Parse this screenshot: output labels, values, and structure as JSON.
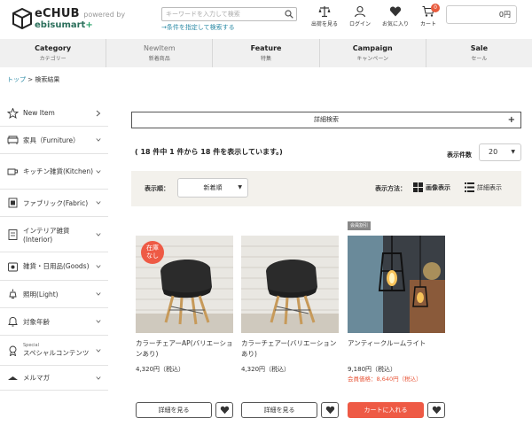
{
  "logo": {
    "name": "eCHUB",
    "powered": "powered by",
    "sub_main": "ebisumart",
    "sub_plus": "+"
  },
  "search": {
    "placeholder": "キーワードを入力して検索",
    "link": "→条件を指定して検索する"
  },
  "header_icons": [
    {
      "label": "出荷を見る",
      "icon": "scale-icon"
    },
    {
      "label": "ログイン",
      "icon": "user-icon"
    },
    {
      "label": "お気に入り",
      "icon": "heart-icon"
    },
    {
      "label": "カート",
      "icon": "cart-icon",
      "badge": "0"
    }
  ],
  "cart_total": "0円",
  "nav": [
    {
      "en": "Category",
      "jp": "カテゴリー"
    },
    {
      "en": "NewItem",
      "jp": "新着商品"
    },
    {
      "en": "Feature",
      "jp": "特集"
    },
    {
      "en": "Campaign",
      "jp": "キャンペーン"
    },
    {
      "en": "Sale",
      "jp": "セール"
    }
  ],
  "breadcrumb": {
    "home": "トップ",
    "sep": " > ",
    "current": "検索結果"
  },
  "sidebar": [
    {
      "label": "New Item",
      "icon": "star-icon"
    },
    {
      "label": "家具（Furniture）",
      "icon": "sofa-icon"
    },
    {
      "label": "キッチン雑貨(Kitchen)",
      "icon": "cup-icon"
    },
    {
      "label": "ファブリック(Fabric)",
      "icon": "fabric-icon"
    },
    {
      "label": "インテリア雑貨(Interior)",
      "icon": "frame-icon"
    },
    {
      "label": "雑貨・日用品(Goods)",
      "icon": "goods-icon"
    },
    {
      "label": "照明(Light)",
      "icon": "lamp-icon"
    },
    {
      "label": "対象年齢",
      "icon": "bell-icon"
    },
    {
      "label": "スペシャルコンテンツ",
      "special": "Special",
      "icon": "ribbon-icon"
    },
    {
      "label": "メルマガ",
      "icon": "mail-icon"
    }
  ],
  "detail_search": {
    "label": "詳細検索",
    "plus": "+"
  },
  "result_text": "( 18 件中 1 件から 18 件を表示しています。)",
  "per_page": {
    "label": "表示件数",
    "value": "20"
  },
  "sort": {
    "label": "表示順：",
    "value": "新着順"
  },
  "view": {
    "label": "表示方法：",
    "image": "画像表示",
    "detail": "詳細表示"
  },
  "products": [
    {
      "name": "カラーチェアーAP(バリエーションあり)",
      "price": "4,320円（税込）",
      "stock_badge": "在庫なし",
      "button": "詳細を見る",
      "member_price": "",
      "member_badge": ""
    },
    {
      "name": "カラーチェアー(バリエーションあり)",
      "price": "4,320円（税込）",
      "stock_badge": "",
      "button": "詳細を見る",
      "member_price": "",
      "member_badge": ""
    },
    {
      "name": "アンティークルームライト",
      "price": "9,180円（税込）",
      "stock_badge": "",
      "button": "カートに入れる",
      "member_price": "会員価格：8,640円（税込）",
      "member_badge": "会員割引"
    }
  ],
  "colors": {
    "accent": "#ee5a45",
    "link": "#2b8aa5",
    "nav_bg": "#f0f0f0",
    "sort_bg": "#f3f1ec"
  }
}
